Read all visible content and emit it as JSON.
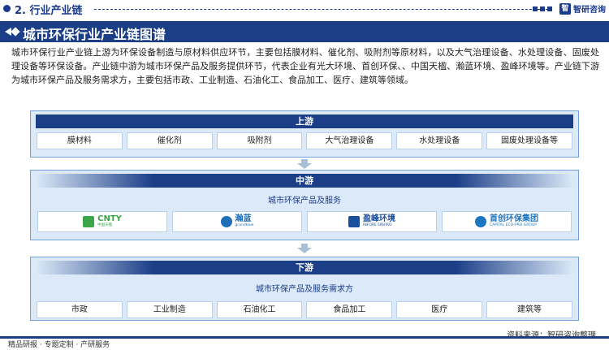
{
  "section": {
    "title": "2. 行业产业链"
  },
  "brand": {
    "mark": "智",
    "name": "智研咨询"
  },
  "main_title": "城市环保行业产业链图谱",
  "intro": "城市环保行业产业链上游为环保设备制造与原材料供应环节，主要包括膜材料、催化剂、吸附剂等原材料，以及大气治理设备、水处理设备、固废处理设备等环保设备。产业链中游为城市环保产品及服务提供环节，代表企业有光大环境、首创环保、、中国天楹、瀚蓝环境、盈峰环境等。产业链下游为城市环保产品及服务需求方，主要包括市政、工业制造、石油化工、食品加工、医疗、建筑等领域。",
  "upstream": {
    "title": "上游",
    "items": [
      "膜材料",
      "催化剂",
      "吸附剂",
      "大气治理设备",
      "水处理设备",
      "固废处理设备等"
    ]
  },
  "midstream": {
    "title": "中游",
    "subtitle": "城市环保产品及服务",
    "logos": [
      {
        "main": "CNTY",
        "sub": "中国天楹",
        "icon": "cnty-logo-icon",
        "color": "#3aa648"
      },
      {
        "main": "瀚蓝",
        "sub": "grandblue",
        "icon": "grandblue-logo-icon",
        "color": "#1f6fb8"
      },
      {
        "main": "盈峰环境",
        "sub": "INFORE ENVIRO",
        "icon": "infore-logo-icon",
        "color": "#1b4f9c"
      },
      {
        "main": "首创环保集团",
        "sub": "CAPITAL ECO-PRO GROUP",
        "icon": "capital-logo-icon",
        "color": "#1c76c0"
      }
    ]
  },
  "downstream": {
    "title": "下游",
    "subtitle": "城市环保产品及服务需求方",
    "items": [
      "市政",
      "工业制造",
      "石油化工",
      "食品加工",
      "医疗",
      "建筑等"
    ]
  },
  "source": "资料来源：智研咨询整理",
  "footer": "精品研报 · 专题定制 · 产研服务",
  "colors": {
    "primary": "#1b3e86",
    "panel": "#dbe9f8",
    "border": "#6fa0d6",
    "arrow": "#a9bfd6"
  }
}
